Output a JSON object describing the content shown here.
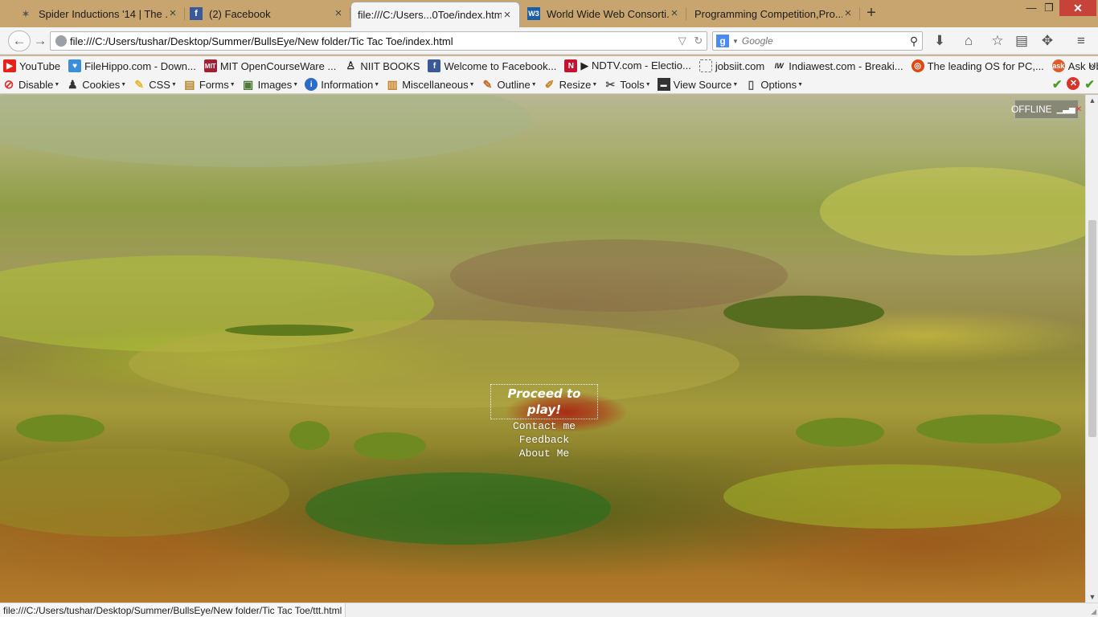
{
  "tabs": [
    {
      "label": "Spider Inductions '14 | The ...",
      "icon": "spider-icon",
      "active": false
    },
    {
      "label": "(2) Facebook",
      "icon": "facebook-icon",
      "active": false
    },
    {
      "label": "file:///C:/Users...0Toe/index.html",
      "icon": "",
      "active": true
    },
    {
      "label": "World Wide Web Consorti...",
      "icon": "w3c-icon",
      "active": false
    },
    {
      "label": "Programming Competition,Pro...",
      "icon": "",
      "active": false
    }
  ],
  "nav": {
    "url": "file:///C:/Users/tushar/Desktop/Summer/BullsEye/New folder/Tic Tac Toe/index.html",
    "search_placeholder": "Google",
    "search_engine_letter": "g"
  },
  "bookmarks": [
    {
      "label": "YouTube",
      "icon": "youtube-icon",
      "color": "#e62117",
      "glyph": "▶"
    },
    {
      "label": "FileHippo.com - Down...",
      "icon": "filehippo-icon",
      "color": "#3a8fd6",
      "glyph": "♥"
    },
    {
      "label": "MIT OpenCourseWare ...",
      "icon": "mit-icon",
      "color": "#a31f34",
      "glyph": "M"
    },
    {
      "label": "NIIT BOOKS",
      "icon": "linux-penguin-icon",
      "color": "#222222",
      "glyph": "♙"
    },
    {
      "label": "Welcome to Facebook...",
      "icon": "facebook-icon",
      "color": "#3b5998",
      "glyph": "f"
    },
    {
      "label": "▶ NDTV.com - Electio...",
      "icon": "ndtv-icon",
      "color": "#c4122f",
      "glyph": "N"
    },
    {
      "label": "jobsiit.com",
      "icon": "page-icon",
      "color": "#ffffff",
      "glyph": ""
    },
    {
      "label": "Indiawest.com - Breaki...",
      "icon": "indiawest-icon",
      "color": "#ffffff",
      "glyph": "IW"
    },
    {
      "label": "The leading OS for PC,...",
      "icon": "ubuntu-icon",
      "color": "#dd4814",
      "glyph": "◎"
    },
    {
      "label": "Ask Ubuntu",
      "icon": "askubuntu-icon",
      "color": "#e05a2b",
      "glyph": "a"
    }
  ],
  "devtools": [
    {
      "label": "Disable",
      "icon": "disable-icon",
      "color": "#d9342b",
      "glyph": "⊘"
    },
    {
      "label": "Cookies",
      "icon": "cookies-icon",
      "color": "#333333",
      "glyph": "♟"
    },
    {
      "label": "CSS",
      "icon": "css-pencil-icon",
      "color": "#e8b82c",
      "glyph": "✎"
    },
    {
      "label": "Forms",
      "icon": "forms-icon",
      "color": "#b5882d",
      "glyph": "▤"
    },
    {
      "label": "Images",
      "icon": "images-icon",
      "color": "#4d7a3a",
      "glyph": "▣"
    },
    {
      "label": "Information",
      "icon": "information-icon",
      "color": "#2b6cc4",
      "glyph": "i"
    },
    {
      "label": "Miscellaneous",
      "icon": "miscellaneous-icon",
      "color": "#c9852b",
      "glyph": "▥"
    },
    {
      "label": "Outline",
      "icon": "outline-pencil-icon",
      "color": "#c46a2b",
      "glyph": "✎"
    },
    {
      "label": "Resize",
      "icon": "resize-icon",
      "color": "#c4862b",
      "glyph": "⤡"
    },
    {
      "label": "Tools",
      "icon": "tools-icon",
      "color": "#555555",
      "glyph": "✂"
    },
    {
      "label": "View Source",
      "icon": "view-source-icon",
      "color": "#333333",
      "glyph": "▬"
    },
    {
      "label": "Options",
      "icon": "options-icon",
      "color": "#555555",
      "glyph": "▯"
    }
  ],
  "page": {
    "proceed": "Proceed to play!",
    "menu": [
      "Contact me",
      "Feedback",
      "About Me"
    ],
    "offline_badge": "OFFLINE"
  },
  "status_text": "file:///C:/Users/tushar/Desktop/Summer/BullsEye/New folder/Tic Tac Toe/ttt.html"
}
